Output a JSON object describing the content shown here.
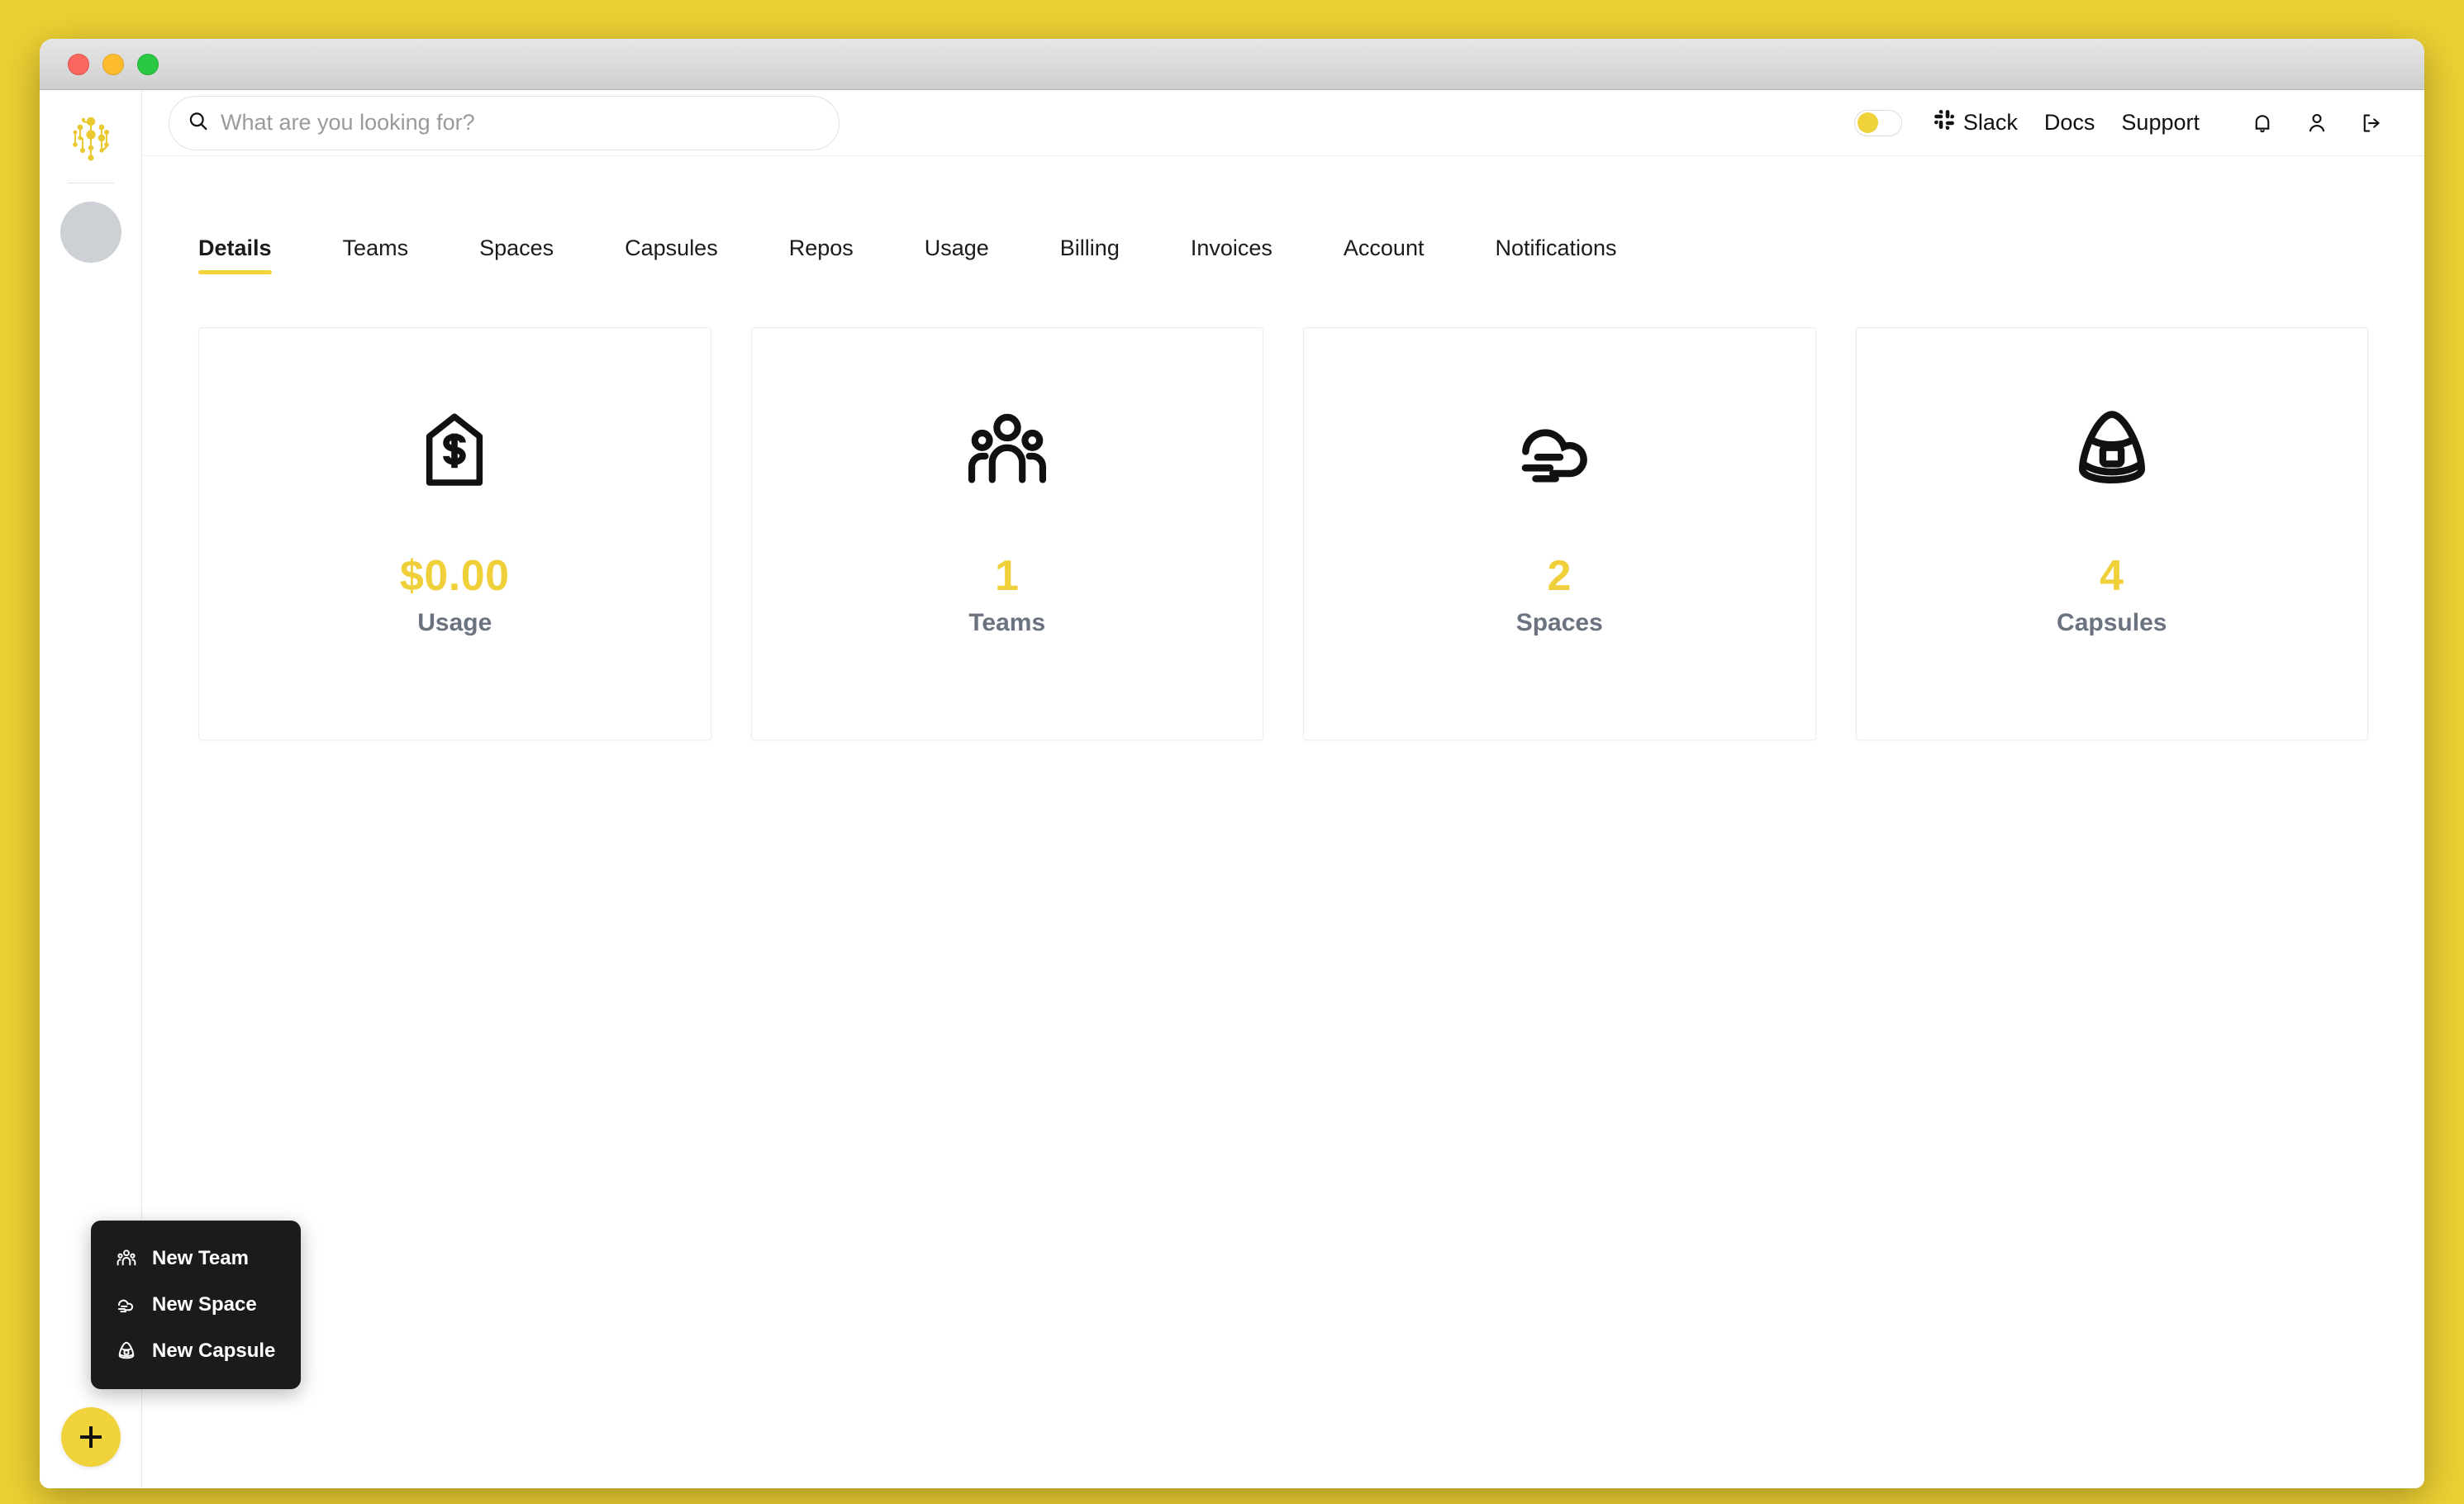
{
  "window": {
    "traffic_lights": [
      "close",
      "minimize",
      "zoom"
    ]
  },
  "sidebar": {
    "logo_name": "network-nodes-logo",
    "avatar_name": "user-avatar",
    "fab_label": "+",
    "context_menu": {
      "items": [
        {
          "label": "New Team",
          "icon": "people-group-icon"
        },
        {
          "label": "New Space",
          "icon": "cloud-wind-icon"
        },
        {
          "label": "New Capsule",
          "icon": "space-capsule-icon"
        }
      ]
    }
  },
  "topbar": {
    "search": {
      "placeholder": "What are you looking for?",
      "value": ""
    },
    "toggle": {
      "state": "off"
    },
    "links": [
      {
        "label": "Slack",
        "icon": "slack-icon"
      },
      {
        "label": "Docs",
        "icon": ""
      },
      {
        "label": "Support",
        "icon": ""
      }
    ],
    "icons": [
      {
        "name": "bell-icon"
      },
      {
        "name": "user-icon"
      },
      {
        "name": "logout-icon"
      }
    ]
  },
  "main": {
    "tabs": [
      {
        "label": "Details",
        "active": true
      },
      {
        "label": "Teams",
        "active": false
      },
      {
        "label": "Spaces",
        "active": false
      },
      {
        "label": "Capsules",
        "active": false
      },
      {
        "label": "Repos",
        "active": false
      },
      {
        "label": "Usage",
        "active": false
      },
      {
        "label": "Billing",
        "active": false
      },
      {
        "label": "Invoices",
        "active": false
      },
      {
        "label": "Account",
        "active": false
      },
      {
        "label": "Notifications",
        "active": false
      }
    ],
    "cards": [
      {
        "value": "$0.00",
        "label": "Usage",
        "icon": "price-tag-dollar-icon"
      },
      {
        "value": "1",
        "label": "Teams",
        "icon": "people-group-icon"
      },
      {
        "value": "2",
        "label": "Spaces",
        "icon": "cloud-wind-icon"
      },
      {
        "value": "4",
        "label": "Capsules",
        "icon": "space-capsule-icon"
      }
    ]
  },
  "colors": {
    "page_background": "#ecd033",
    "accent_yellow": "#f0d03a",
    "menu_background": "#1b1b1b",
    "label_gray": "#6b7280"
  }
}
